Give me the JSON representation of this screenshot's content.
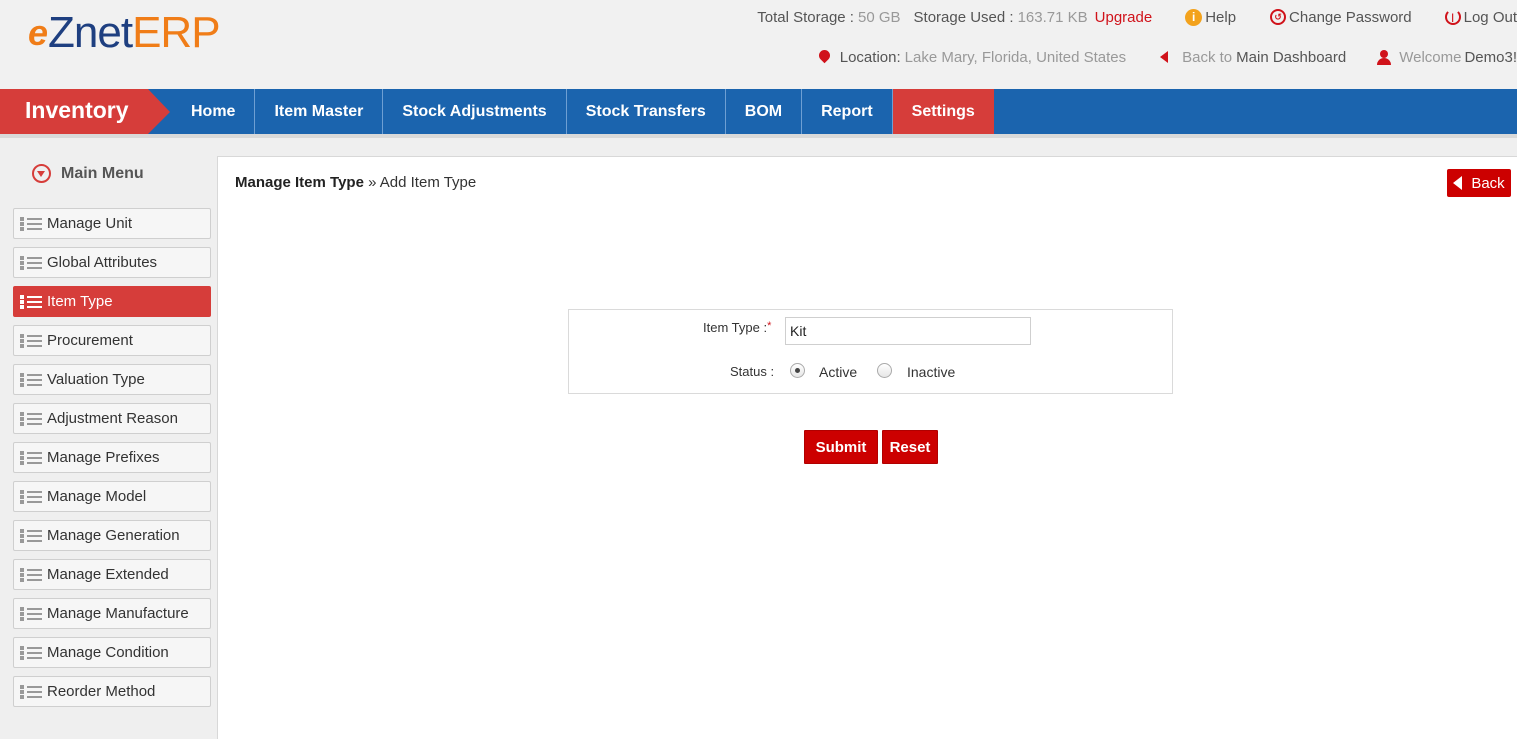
{
  "brand": {
    "e": "e",
    "znet": "Znet",
    "erp": "ERP"
  },
  "topbar": {
    "total_storage_label": "Total Storage :",
    "total_storage_value": "50 GB",
    "storage_used_label": "Storage Used :",
    "storage_used_value": "163.71 KB",
    "upgrade": "Upgrade",
    "help": "Help",
    "change_password": "Change Password",
    "logout": "Log Out",
    "location_label": "Location:",
    "location_value": "Lake Mary, Florida, United States",
    "back_to": "Back to",
    "main_dashboard": "Main Dashboard",
    "welcome": "Welcome",
    "username": "Demo3!"
  },
  "module": "Inventory",
  "nav": {
    "items": [
      {
        "label": "Home"
      },
      {
        "label": "Item Master"
      },
      {
        "label": "Stock Adjustments"
      },
      {
        "label": "Stock Transfers"
      },
      {
        "label": "BOM"
      },
      {
        "label": "Report"
      },
      {
        "label": "Settings",
        "active": true
      }
    ]
  },
  "sidebar": {
    "title": "Main Menu",
    "items": [
      {
        "label": "Manage Unit"
      },
      {
        "label": "Global Attributes"
      },
      {
        "label": "Item Type",
        "active": true
      },
      {
        "label": "Procurement"
      },
      {
        "label": "Valuation Type"
      },
      {
        "label": "Adjustment Reason"
      },
      {
        "label": "Manage Prefixes"
      },
      {
        "label": "Manage Model"
      },
      {
        "label": "Manage Generation"
      },
      {
        "label": "Manage Extended"
      },
      {
        "label": "Manage Manufacture"
      },
      {
        "label": "Manage Condition"
      },
      {
        "label": "Reorder Method"
      }
    ]
  },
  "content": {
    "breadcrumb_parent": "Manage Item Type",
    "breadcrumb_sep": " » ",
    "breadcrumb_current": "Add Item Type",
    "back_button": "Back",
    "form": {
      "item_type_label": "Item Type :",
      "required_mark": "*",
      "item_type_value": "Kit",
      "status_label": "Status :",
      "status_options": [
        "Active",
        "Inactive"
      ],
      "status_selected": "Active"
    },
    "submit": "Submit",
    "reset": "Reset"
  },
  "colors": {
    "nav_blue": "#1b64ae",
    "accent_red": "#d63d3a",
    "button_red": "#cc0000"
  }
}
